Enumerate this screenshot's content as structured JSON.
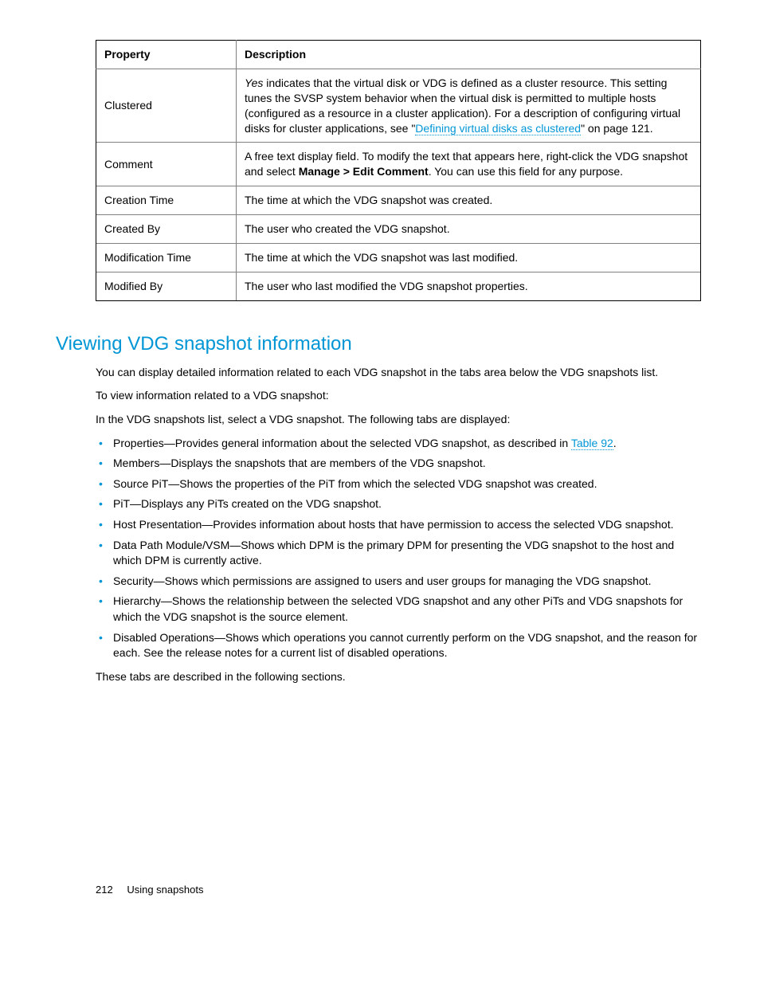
{
  "table": {
    "headers": [
      "Property",
      "Description"
    ],
    "rows": [
      {
        "property": "Clustered",
        "desc_pre_italic": "Yes",
        "desc_part1": " indicates that the virtual disk or VDG is defined as a cluster resource. This setting tunes the SVSP system behavior when the virtual disk is permitted to multiple hosts (configured as a resource in a cluster application). For a description of configuring virtual disks for cluster applications, see \"",
        "desc_link": "Defining virtual disks as clustered",
        "desc_part2": "\" on page 121."
      },
      {
        "property": "Comment",
        "desc_part1": "A free text display field. To modify the text that appears here, right-click the VDG snapshot and select ",
        "desc_bold": "Manage > Edit Comment",
        "desc_part2": ". You can use this field for any purpose."
      },
      {
        "property": "Creation Time",
        "desc": "The time at which the VDG snapshot was created."
      },
      {
        "property": "Created By",
        "desc": "The user who created the VDG snapshot."
      },
      {
        "property": "Modification Time",
        "desc": "The time at which the VDG snapshot was last modified."
      },
      {
        "property": "Modified By",
        "desc": "The user who last modified the VDG snapshot properties."
      }
    ]
  },
  "heading": "Viewing VDG snapshot information",
  "para1": "You can display detailed information related to each VDG snapshot in the tabs area below the VDG snapshots list.",
  "para2": "To view information related to a VDG snapshot:",
  "para3": "In the VDG snapshots list, select a VDG snapshot. The following tabs are displayed:",
  "bullets": [
    {
      "pre": "Properties—Provides general information about the selected VDG snapshot, as described in ",
      "link": "Table 92",
      "post": "."
    },
    {
      "text": "Members—Displays the snapshots that are members of the VDG snapshot."
    },
    {
      "text": "Source PiT—Shows the properties of the PiT from which the selected VDG snapshot was created."
    },
    {
      "text": "PiT—Displays any PiTs created on the VDG snapshot."
    },
    {
      "text": "Host Presentation—Provides information about hosts that have permission to access the selected VDG snapshot."
    },
    {
      "text": "Data Path Module/VSM—Shows which DPM is the primary DPM for presenting the VDG snapshot to the host and which DPM is currently active."
    },
    {
      "text": "Security—Shows which permissions are assigned to users and user groups for managing the VDG snapshot."
    },
    {
      "text": "Hierarchy—Shows the relationship between the selected VDG snapshot and any other PiTs and VDG snapshots for which the VDG snapshot is the source element."
    },
    {
      "text": "Disabled Operations—Shows which operations you cannot currently perform on the VDG snapshot, and the reason for each. See the release notes for a current list of disabled operations."
    }
  ],
  "para4": "These tabs are described in the following sections.",
  "footer": {
    "page": "212",
    "title": "Using snapshots"
  }
}
